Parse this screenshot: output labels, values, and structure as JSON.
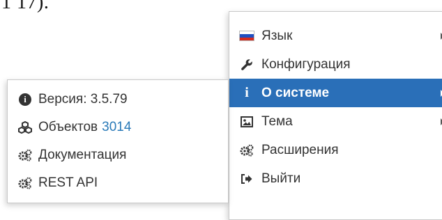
{
  "page_fragment": {
    "text": "1 17)."
  },
  "main_menu": {
    "items": [
      {
        "label": "Язык",
        "icon": "russia-flag-icon",
        "has_submenu": true,
        "active": false
      },
      {
        "label": "Конфигурация",
        "icon": "wrench-icon",
        "has_submenu": false,
        "active": false
      },
      {
        "label": "О системе",
        "icon": "info-icon",
        "has_submenu": true,
        "active": true
      },
      {
        "label": "Тема",
        "icon": "picture-icon",
        "has_submenu": true,
        "active": false
      },
      {
        "label": "Расширения",
        "icon": "gears-icon",
        "has_submenu": false,
        "active": false
      },
      {
        "label": "Выйти",
        "icon": "sign-out-icon",
        "has_submenu": false,
        "active": false
      }
    ]
  },
  "about_submenu": {
    "version_label": "Версия: 3.5.79",
    "objects_label": "Объектов",
    "objects_count": "3014",
    "docs_label": "Документация",
    "rest_api_label": "REST API"
  },
  "colors": {
    "active_background": "#2a6fb8",
    "count_text": "#2a7ab8",
    "flag_white": "#ffffff",
    "flag_blue": "#1f4fc1",
    "flag_red": "#d52b1e"
  }
}
